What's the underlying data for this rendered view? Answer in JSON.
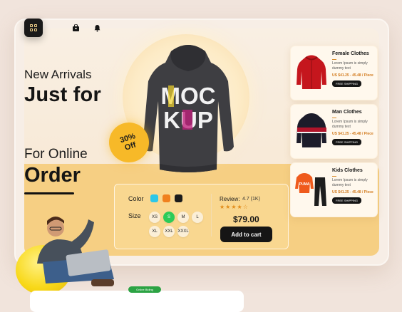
{
  "hero": {
    "new_arrivals": "New Arrivals",
    "just_for": "Just for",
    "for_online": "For Online",
    "order": "Order",
    "discount": "30% Off",
    "mockup_text": [
      "MOC",
      "KUP"
    ]
  },
  "options": {
    "color_label": "Color",
    "colors": [
      "#2dc7e8",
      "#f0801e",
      "#1b1b1b"
    ],
    "size_label": "Size",
    "sizes": [
      "XS",
      "S",
      "M",
      "L",
      "XL",
      "XXL",
      "XXXL"
    ],
    "selected_size": "S",
    "review_label": "Review:",
    "review_value": "4.7 (1K)",
    "rating": 4,
    "stars": "★★★★☆",
    "price": "$79.00",
    "cart_label": "Add to cart"
  },
  "products": [
    {
      "name": "Female Clothes",
      "desc": "Lorem Ipsum is simply dummy text",
      "price": "US $41.25 - 45.48 / Piece",
      "button": "FREE SHIPPING",
      "icon": "red-jacket"
    },
    {
      "name": "Man Clothes",
      "desc": "Lorem Ipsum is simply dummy text",
      "price": "US $41.25 - 45.48 / Piece",
      "button": "FREE SHIPPING",
      "icon": "striped-jacket"
    },
    {
      "name": "Kids Clothes",
      "desc": "Lorem Ipsum is simply dummy text",
      "price": "US $41.25 - 45.48 / Piece",
      "button": "FREE SHIPPING",
      "icon": "kids-tracksuit"
    }
  ],
  "footer": {
    "badge": "Online Biding"
  },
  "icons": {
    "menu": "grid-icon",
    "cart": "shop-bag-icon",
    "notify": "bell-icon"
  },
  "colors": {
    "accent": "#f6cf83",
    "dark": "#151515",
    "selected": "#2ccb58",
    "discount": "#f7b928"
  }
}
